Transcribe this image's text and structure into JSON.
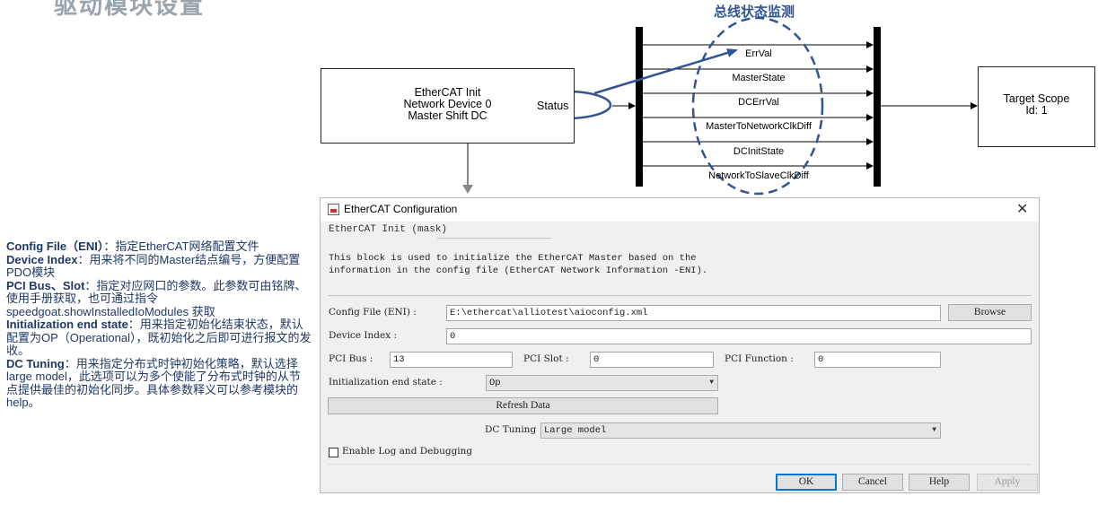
{
  "slide": {
    "title": "驱动模块设置"
  },
  "diagram": {
    "title": "总线状态监测",
    "init_block": {
      "lines": [
        "EtherCAT Init",
        "Network Device 0",
        "Master Shift DC"
      ],
      "port_label": "Status"
    },
    "bus_signals": [
      "ErrVal",
      "MasterState",
      "DCErrVal",
      "MasterToNetworkClkDiff",
      "DCInitState",
      "NetworkToSlaveClkDiff"
    ],
    "scope_block": {
      "lines": [
        "Target Scope",
        "Id: 1"
      ]
    },
    "colors": {
      "annotation": "#2f5597",
      "signal_line": "#000000"
    }
  },
  "description": [
    {
      "key": "Config File（ENI）",
      "text": "：指定EtherCAT网络配置文件"
    },
    {
      "key": "Device Index",
      "text": "：用来将不同的Master结点编号，方便配置PDO模块"
    },
    {
      "key": "PCI Bus、Slot",
      "text": "：指定对应网口的参数。此参数可由铭牌、使用手册获取，也可通过指令speedgoat.showInstalledIoModules 获取"
    },
    {
      "key": "Initialization end state",
      "text": "：用来指定初始化结束状态，默认配置为OP（Operational），既初始化之后即可进行报文的发收。"
    },
    {
      "key": "DC Tuning",
      "text": "：用来指定分布式时钟初始化策略，默认选择 large model，此选项可以为多个使能了分布式时钟的从节点提供最佳的初始化同步。具体参数释义可以参考模块的help。"
    }
  ],
  "dialog": {
    "title": "EtherCAT Configuration",
    "close_icon": "close-icon",
    "mask_label": "EtherCAT Init (mask)",
    "description_lines": [
      "This block is used to initialize the EtherCAT Master based on the",
      "information in the config file (EtherCAT Network Information -ENI)."
    ],
    "config_file": {
      "label": "Config File (ENI) :",
      "value": "E:\\ethercat\\alliotest\\aioconfig.xml",
      "browse_label": "Browse"
    },
    "device_index": {
      "label": "Device Index :",
      "value": "0"
    },
    "pci_bus": {
      "label": "PCI Bus :",
      "value": "13"
    },
    "pci_slot": {
      "label": "PCI Slot :",
      "value": "0"
    },
    "pci_function": {
      "label": "PCI Function :",
      "value": "0"
    },
    "init_end_state": {
      "label": "Initialization end state :",
      "value": "Op"
    },
    "refresh_label": "Refresh Data",
    "dc_tuning": {
      "label": "DC Tuning",
      "value": "Large model"
    },
    "enable_log": {
      "label": "Enable Log and Debugging",
      "checked": false
    },
    "buttons": {
      "ok": "OK",
      "cancel": "Cancel",
      "help": "Help",
      "apply": "Apply"
    }
  }
}
